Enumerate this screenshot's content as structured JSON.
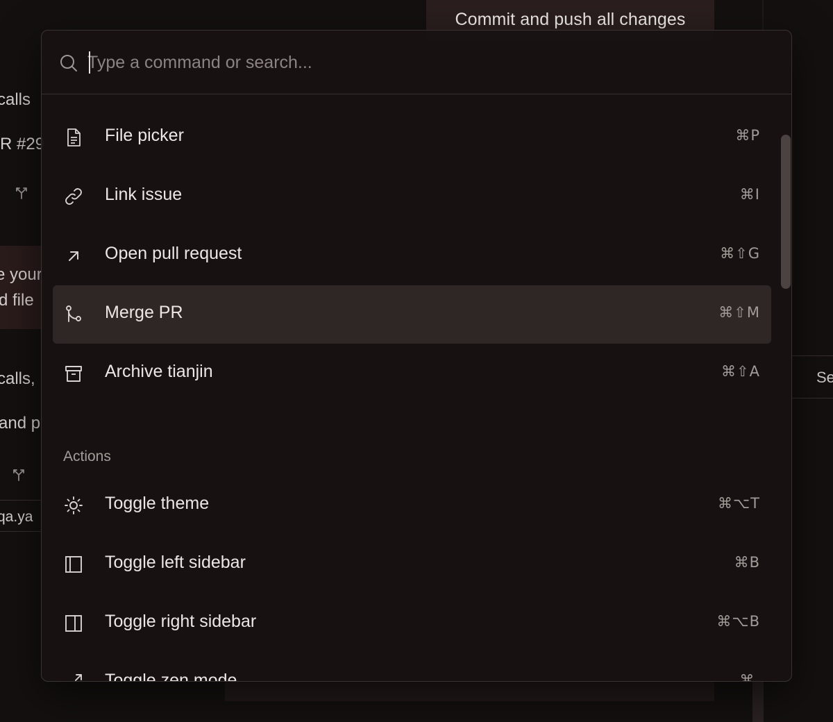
{
  "background": {
    "commit_button": "Commit and push all changes",
    "left_fragments": [
      "calls",
      "R #29",
      "e your",
      "d file",
      "calls,",
      "and p",
      "qa.ya"
    ],
    "right_fragment": "Se"
  },
  "palette": {
    "search": {
      "placeholder": "Type a command or search...",
      "value": ""
    },
    "items": [
      {
        "label": "File picker",
        "shortcut": "⌘P",
        "icon": "file-icon"
      },
      {
        "label": "Link issue",
        "shortcut": "⌘I",
        "icon": "link-icon"
      },
      {
        "label": "Open pull request",
        "shortcut": "⌘⇧G",
        "icon": "arrow-up-right-icon"
      },
      {
        "label": "Merge PR",
        "shortcut": "⌘⇧M",
        "icon": "git-merge-icon",
        "highlighted": true
      },
      {
        "label": "Archive tianjin",
        "shortcut": "⌘⇧A",
        "icon": "archive-icon"
      }
    ],
    "actions_section": {
      "title": "Actions",
      "items": [
        {
          "label": "Toggle theme",
          "shortcut": "⌘⌥T",
          "icon": "sun-icon"
        },
        {
          "label": "Toggle left sidebar",
          "shortcut": "⌘B",
          "icon": "sidebar-left-icon"
        },
        {
          "label": "Toggle right sidebar",
          "shortcut": "⌘⌥B",
          "icon": "sidebar-right-icon"
        },
        {
          "label": "Toggle zen mode",
          "shortcut": "⌘.",
          "icon": "expand-icon"
        }
      ]
    }
  }
}
